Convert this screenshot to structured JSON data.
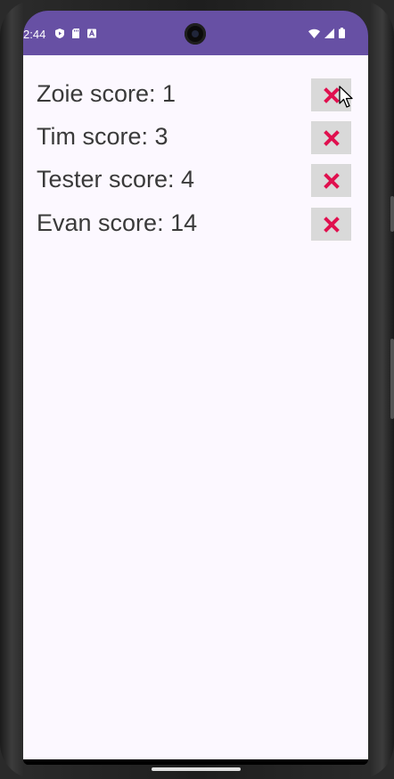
{
  "status_bar": {
    "time": "2:44",
    "background_color": "#6750a4",
    "left_icons": [
      "shield-play-icon",
      "sd-card-icon",
      "font-a-icon"
    ],
    "right_icons": [
      "wifi-icon",
      "cellular-signal-icon",
      "battery-icon"
    ]
  },
  "scores": [
    {
      "label": "Zoie score: 1"
    },
    {
      "label": "Tim score: 3"
    },
    {
      "label": "Tester score: 4"
    },
    {
      "label": "Evan score: 14"
    }
  ],
  "delete_icon": "close-x-icon",
  "accent_delete_color": "#e0104f",
  "content_background": "#fcf8ff"
}
